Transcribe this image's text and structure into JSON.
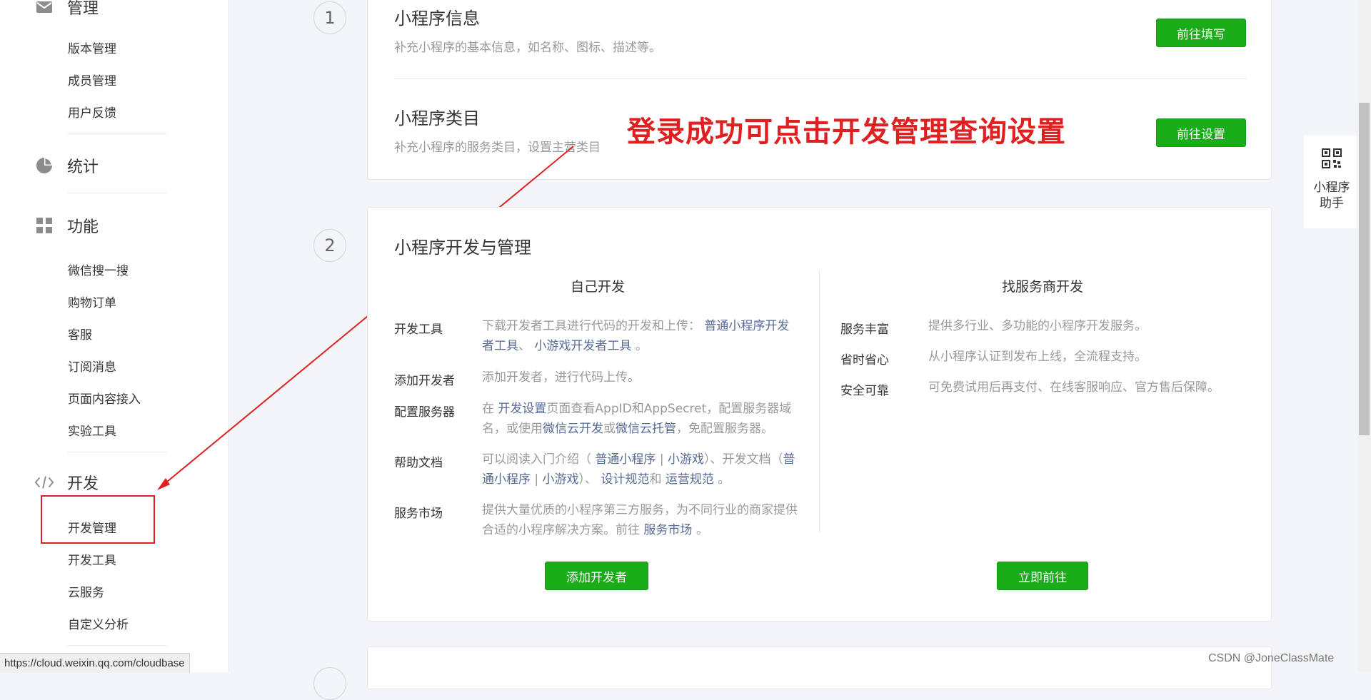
{
  "sidebar": {
    "top_section": "管理",
    "manage_items": [
      "版本管理",
      "成员管理",
      "用户反馈"
    ],
    "stats_section": "统计",
    "features_section": "功能",
    "features_items": [
      "微信搜一搜",
      "购物订单",
      "客服",
      "订阅消息",
      "页面内容接入",
      "实验工具"
    ],
    "dev_section": "开发",
    "dev_items": [
      "开发管理",
      "开发工具",
      "云服务",
      "自定义分析"
    ]
  },
  "status_url": "https://cloud.weixin.qq.com/cloudbase",
  "step1": {
    "number": "1",
    "info_title": "小程序信息",
    "info_desc": "补充小程序的基本信息，如名称、图标、描述等。",
    "info_button": "前往填写",
    "category_title": "小程序类目",
    "category_desc": "补充小程序的服务类目，设置主营类目",
    "category_button": "前往设置"
  },
  "annotation": "登录成功可点击开发管理查询设置",
  "step2": {
    "number": "2",
    "title": "小程序开发与管理",
    "self_dev": {
      "heading": "自己开发",
      "rows": [
        {
          "label": "开发工具",
          "p1": "下载开发者工具进行代码的开发和上传：",
          "l1": "普通小程序开发者工具",
          "p2": "、",
          "l2": "小游戏开发者工具",
          "p3": "。"
        },
        {
          "label": "添加开发者",
          "p1": "添加开发者，进行代码上传。"
        },
        {
          "label": "配置服务器",
          "p1": "在 ",
          "l1": "开发设置",
          "p2": "页面查看AppID和AppSecret，配置服务器域名，或使用",
          "l2": "微信云开发",
          "p3": "或",
          "l3": "微信云托管",
          "p4": "，免配置服务器。"
        },
        {
          "label": "帮助文档",
          "p1": "可以阅读入门介绍（",
          "l1": "普通小程序",
          "p2": "|",
          "l2": "小游戏",
          "p3": "）、开发文档（",
          "l3": "普通小程序",
          "p4": "|",
          "l4": "小游戏",
          "p5": "）、",
          "l5": "设计规范",
          "p6": "和",
          "l6": "运营规范",
          "p7": "。"
        },
        {
          "label": "服务市场",
          "p1": "提供大量优质的小程序第三方服务，为不同行业的商家提供合适的小程序解决方案。前往 ",
          "l1": "服务市场",
          "p2": "。"
        }
      ],
      "button": "添加开发者"
    },
    "provider_dev": {
      "heading": "找服务商开发",
      "rows": [
        {
          "label": "服务丰富",
          "desc": "提供多行业、多功能的小程序开发服务。"
        },
        {
          "label": "省时省心",
          "desc": "从小程序认证到发布上线，全流程支持。"
        },
        {
          "label": "安全可靠",
          "desc": "可免费试用后再支付、在线客服响应、官方售后保障。"
        }
      ],
      "button": "立即前往"
    }
  },
  "helper": {
    "label": "小程序助手",
    "icon": "qr-code-icon"
  },
  "watermark": "CSDN @JoneClassMate",
  "colors": {
    "accent_green": "#1aad19",
    "link": "#576b95",
    "annotation_red": "#e02020"
  }
}
